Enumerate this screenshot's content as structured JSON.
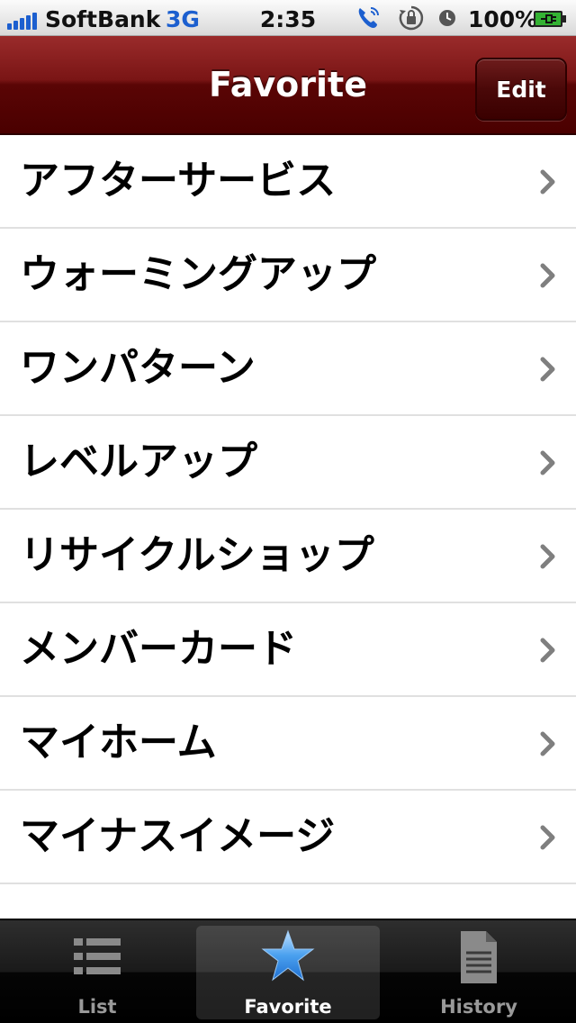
{
  "status_bar": {
    "carrier": "SoftBank",
    "network": "3G",
    "time": "2:35",
    "battery_percent": "100%",
    "icons": [
      "signal-icon",
      "phone-icon",
      "rotation-lock-icon",
      "alarm-clock-icon",
      "battery-charging-icon"
    ]
  },
  "nav": {
    "title": "Favorite",
    "edit_label": "Edit"
  },
  "favorites": [
    {
      "label": "アフターサービス"
    },
    {
      "label": "ウォーミングアップ"
    },
    {
      "label": "ワンパターン"
    },
    {
      "label": "レベルアップ"
    },
    {
      "label": "リサイクルショップ"
    },
    {
      "label": "メンバーカード"
    },
    {
      "label": "マイホーム"
    },
    {
      "label": "マイナスイメージ"
    }
  ],
  "tabs": [
    {
      "label": "List",
      "icon": "list-icon"
    },
    {
      "label": "Favorite",
      "icon": "star-icon"
    },
    {
      "label": "History",
      "icon": "document-icon"
    }
  ],
  "selected_tab": "Favorite",
  "colors": {
    "nav_bar": "#7a1515",
    "tab_selected_icon": "#3a8ee6"
  }
}
